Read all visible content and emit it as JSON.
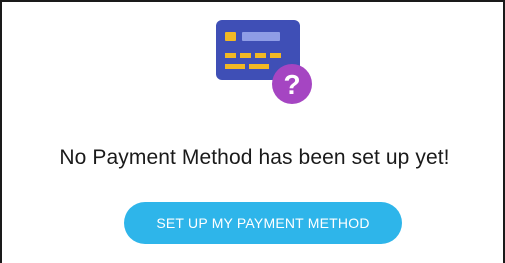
{
  "empty_state": {
    "icon": "credit-card-question-icon",
    "message": "No Payment Method has been set up yet!",
    "cta_label": "SET UP MY PAYMENT METHOD"
  },
  "colors": {
    "card": "#3f4fb6",
    "card_chip": "#f2b824",
    "card_stripe": "#8f9de6",
    "badge": "#a545c2",
    "button": "#2eb5ea",
    "text": "#1a1a1a"
  }
}
